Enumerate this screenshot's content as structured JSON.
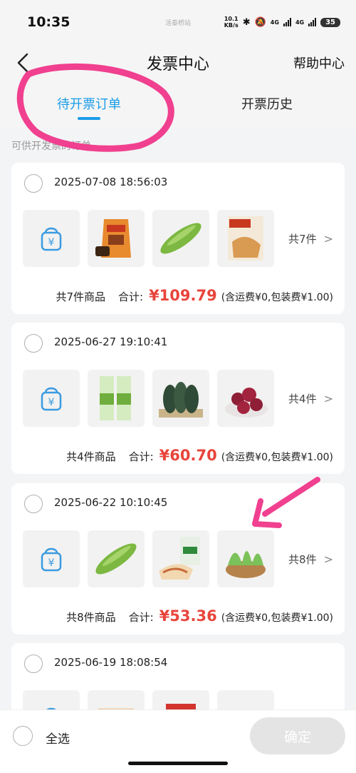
{
  "status_bar": {
    "time": "10:35",
    "center_text": "活泰桥站",
    "net_speed_value": "10.1",
    "net_speed_unit": "KB/s",
    "signal1": "4G",
    "signal2": "4G",
    "battery": "35"
  },
  "header": {
    "title": "发票中心",
    "help_label": "帮助中心"
  },
  "tabs": [
    {
      "label": "待开票订单",
      "active": true
    },
    {
      "label": "开票历史",
      "active": false
    }
  ],
  "hint": "可供开发票的订单",
  "orders": [
    {
      "date": "2025-07-08 18:56:03",
      "count_label": "共7件",
      "items_label": "共7件商品",
      "total_label": "合计:",
      "amount": "¥109.79",
      "fees": "(含运费¥0,包装费¥1.00)",
      "thumbs": [
        "bag",
        "snack-bag",
        "gourd",
        "snack-box"
      ]
    },
    {
      "date": "2025-06-27 19:10:41",
      "count_label": "共4件",
      "items_label": "共4件商品",
      "total_label": "合计:",
      "amount": "¥60.70",
      "fees": "(含运费¥0,包装费¥1.00)",
      "thumbs": [
        "bag",
        "drink-cartons",
        "kale",
        "bayberry"
      ]
    },
    {
      "date": "2025-06-22 10:10:45",
      "count_label": "共8件",
      "items_label": "共8件商品",
      "total_label": "合计:",
      "amount": "¥53.36",
      "fees": "(含运费¥0,包装费¥1.00)",
      "thumbs": [
        "bag",
        "gourd",
        "fish-pack",
        "greens-basket"
      ]
    },
    {
      "date": "2025-06-19 18:08:54",
      "thumbs": [
        "bag",
        "food-pack",
        "red-pack",
        "plate"
      ]
    }
  ],
  "bottom_bar": {
    "select_all_label": "全选",
    "confirm_label": "确定"
  },
  "colors": {
    "accent": "#1a9ce8",
    "price": "#e8453c",
    "annotation": "#f0408f"
  }
}
